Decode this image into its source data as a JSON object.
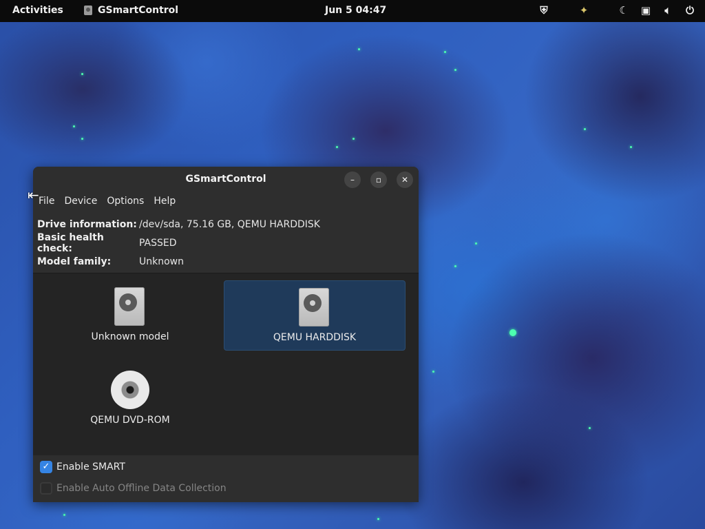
{
  "topbar": {
    "activities": "Activities",
    "app_name": "GSmartControl",
    "clock": "Jun 5  04:47",
    "tray_icons": [
      "shield-icon",
      "software-updates-icon",
      "night-light-icon",
      "screen-icon",
      "volume-icon",
      "power-icon"
    ]
  },
  "window": {
    "title": "GSmartControl",
    "controls": {
      "minimize": "–",
      "maximize": "▫",
      "close": "✕"
    },
    "menu": [
      "File",
      "Device",
      "Options",
      "Help"
    ],
    "info": {
      "drive_label": "Drive information:",
      "drive_value": "/dev/sda, 75.16 GB, QEMU HARDDISK",
      "health_label": "Basic health check:",
      "health_value": "PASSED",
      "family_label": "Model family:",
      "family_value": "Unknown"
    },
    "devices": [
      {
        "label": "Unknown model",
        "icon": "hard-disk-icon",
        "selected": false
      },
      {
        "label": "QEMU HARDDISK",
        "icon": "hard-disk-icon",
        "selected": true
      },
      {
        "label": "QEMU DVD-ROM",
        "icon": "optical-disc-icon",
        "selected": false
      }
    ],
    "options": {
      "enable_smart": {
        "label": "Enable SMART",
        "checked": true
      },
      "auto_offline": {
        "label": "Enable Auto Offline Data Collection",
        "checked": false,
        "disabled": true
      }
    }
  },
  "colors": {
    "accent": "#3584e4",
    "selection": "#1f3a5a",
    "window_bg": "#242424",
    "topbar_bg": "#0b0b0b"
  }
}
